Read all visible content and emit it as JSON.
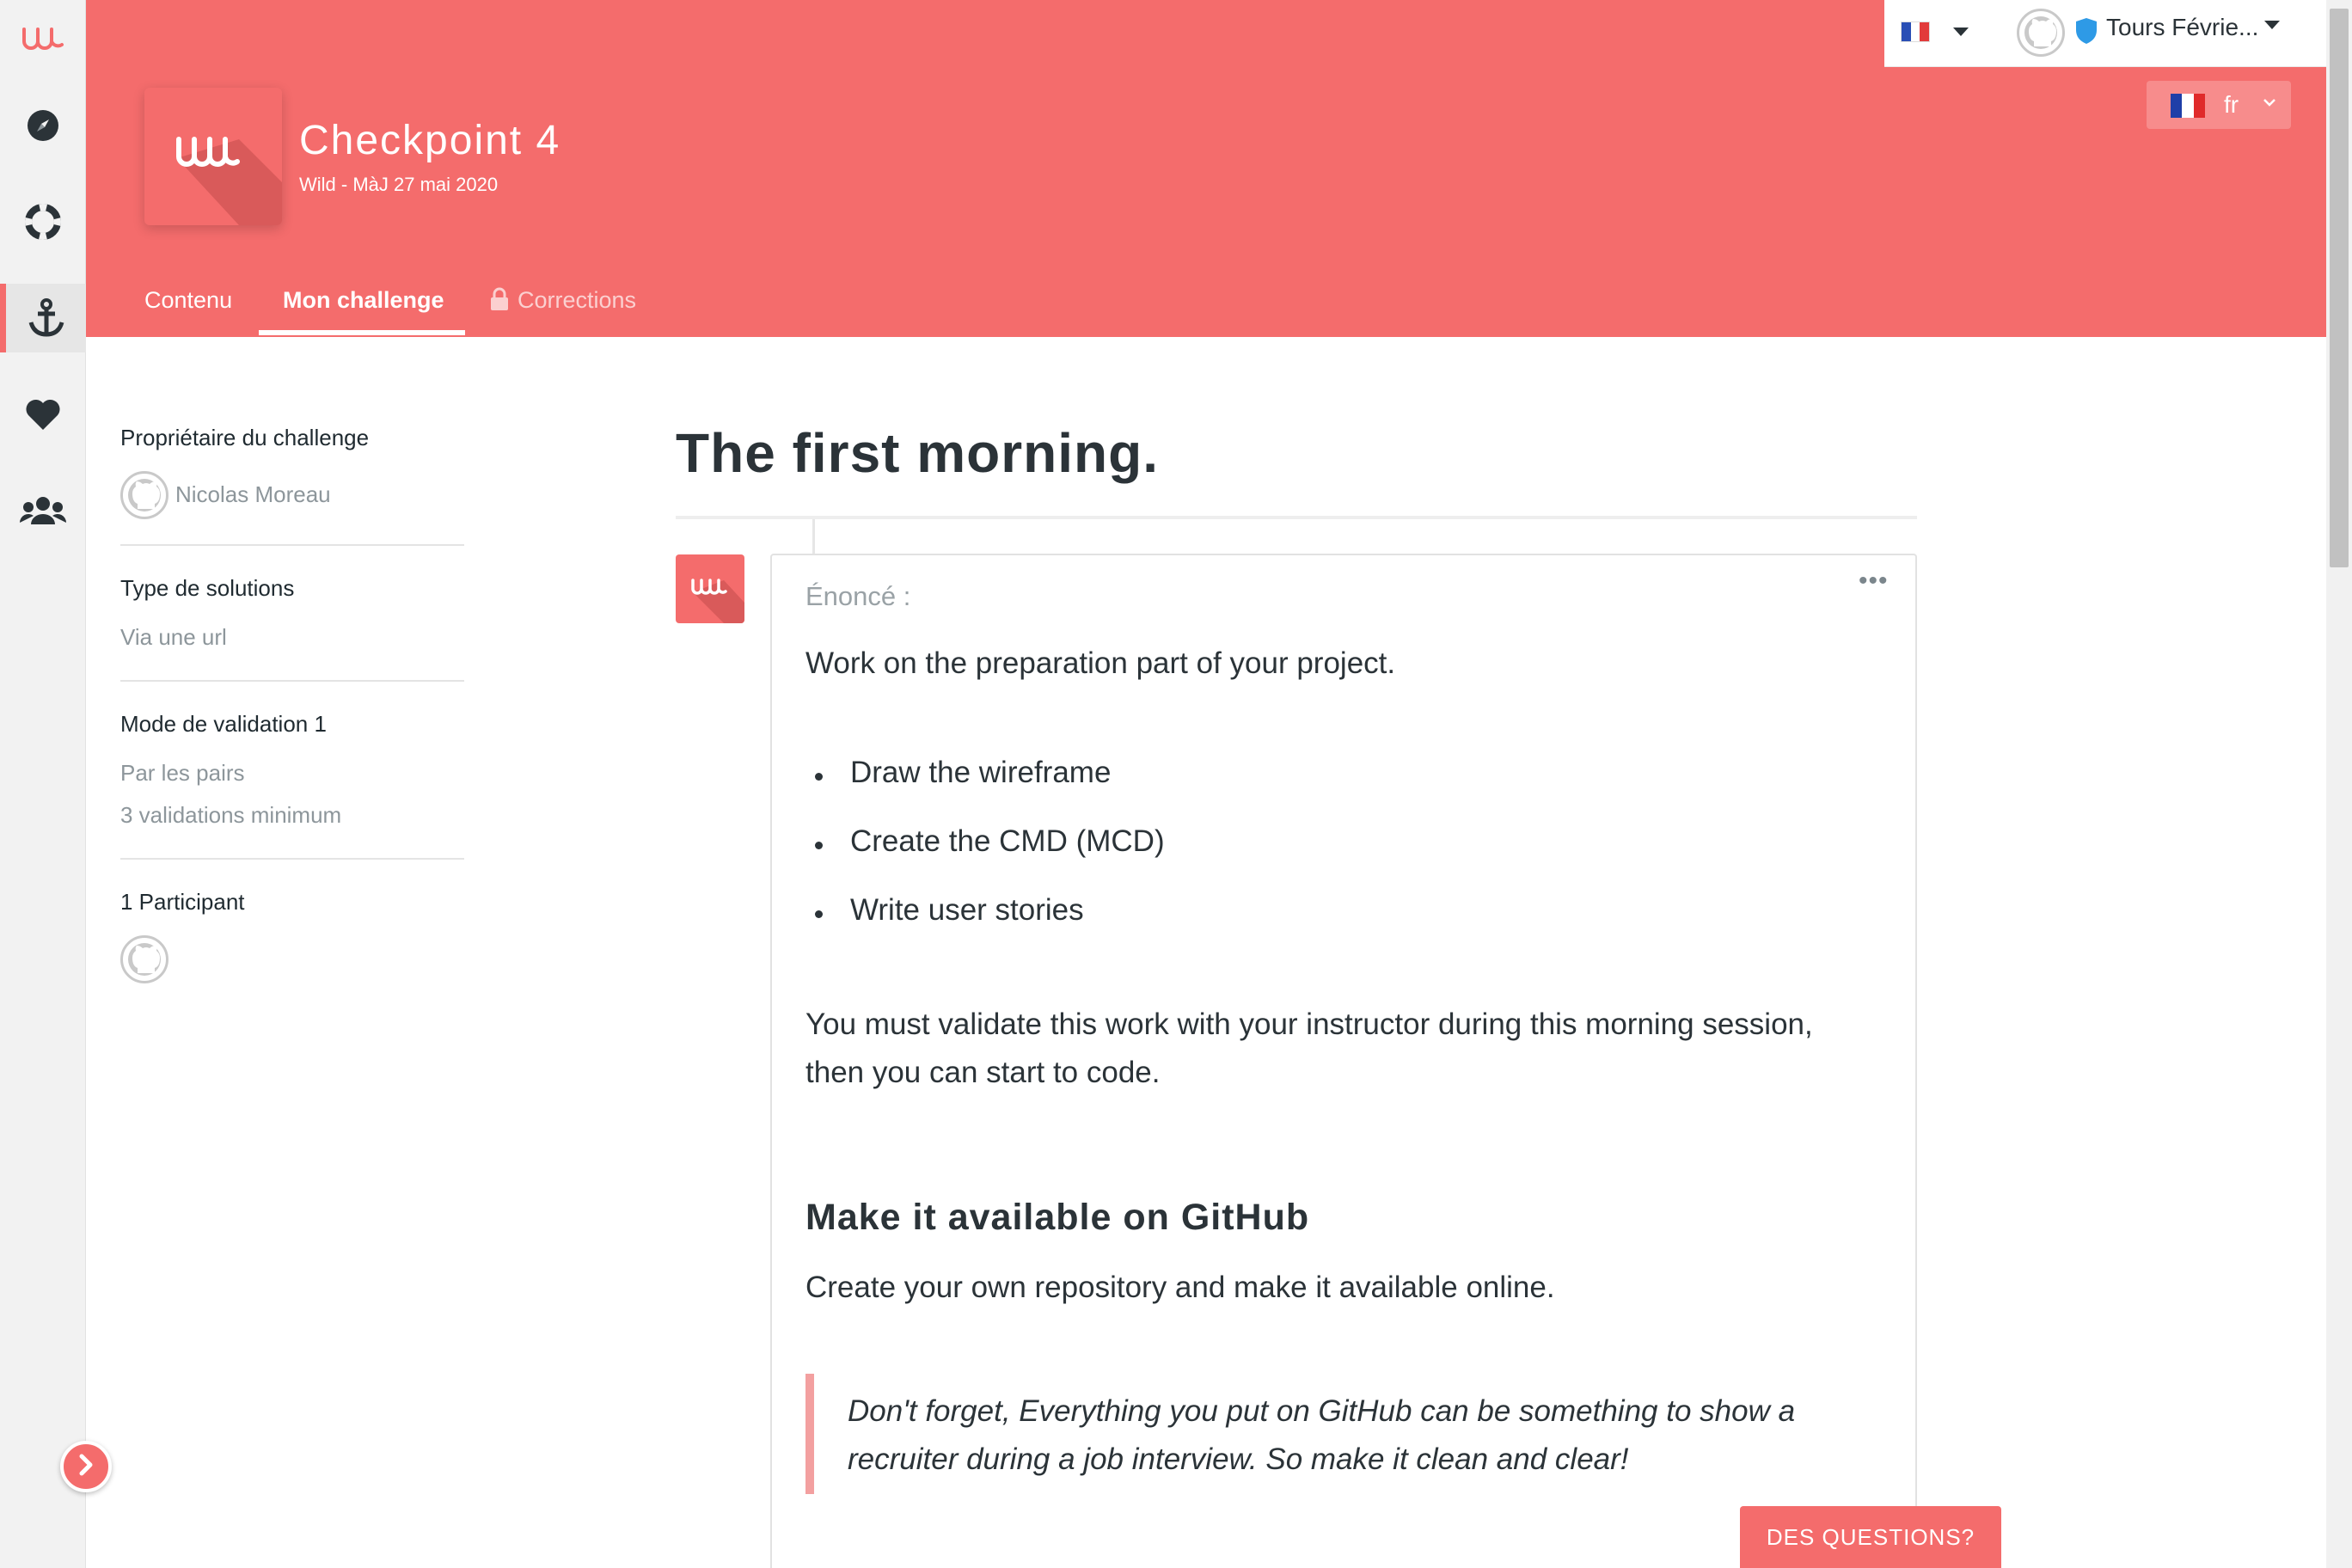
{
  "sidebar": {
    "items": [
      {
        "name": "wild-logo-icon"
      },
      {
        "name": "compass-icon"
      },
      {
        "name": "lifebuoy-icon"
      },
      {
        "name": "anchor-icon",
        "active": true
      },
      {
        "name": "heart-icon"
      },
      {
        "name": "users-icon"
      }
    ],
    "toggle_icon": "chevron-right-icon"
  },
  "header": {
    "title": "Checkpoint 4",
    "subtitle": "Wild - MàJ 27 mai 2020",
    "tabs": [
      {
        "label": "Contenu",
        "active": false
      },
      {
        "label": "Mon challenge",
        "active": true
      },
      {
        "label": "Corrections",
        "locked": true
      }
    ],
    "account": {
      "campus": "Tours Févrie..."
    },
    "language": {
      "code": "fr"
    }
  },
  "info": {
    "owner_label": "Propriétaire du challenge",
    "owner_name": "Nicolas Moreau",
    "solution_type_label": "Type de solutions",
    "solution_type_value": "Via une url",
    "validation_label": "Mode de validation 1",
    "validation_mode": "Par les pairs",
    "validation_min": "3 validations minimum",
    "participants_label": "1 Participant"
  },
  "content": {
    "title": "The first morning.",
    "label": "Énoncé :",
    "intro": "Work on the preparation part of your project.",
    "list": [
      "Draw the wireframe",
      "Create the CMD (MCD)",
      "Write user stories"
    ],
    "paragraph_line1": "You must validate this work with your instructor during this morning session,",
    "paragraph_line2": "then you can start to code.",
    "section_heading": "Make it available on GitHub",
    "section_text": "Create your own repository and make it available online.",
    "quote_line1": "Don't forget, Everything you put on GitHub can be something to show a",
    "quote_line2": "recruiter during a job interview. So make it clean and clear!"
  },
  "questions_button": "DES QUESTIONS?",
  "colors": {
    "brand": "#f46c6c",
    "text_dark": "#2b3338",
    "text_muted": "#8d969b"
  }
}
